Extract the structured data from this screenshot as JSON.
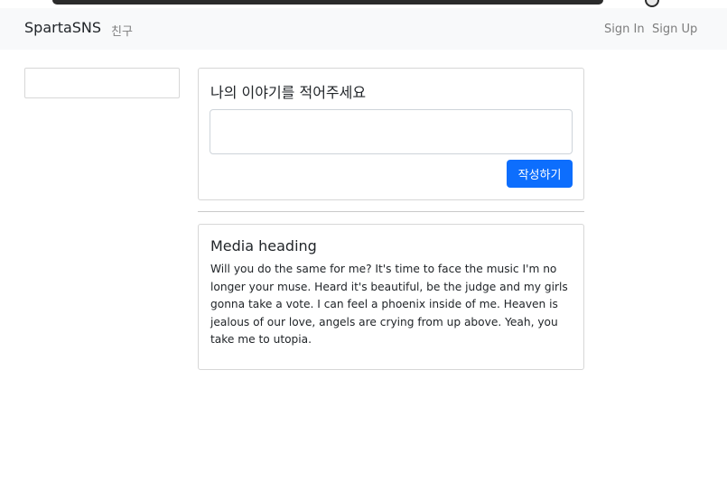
{
  "navbar": {
    "brand": "SpartaSNS",
    "friend_link": "친구",
    "sign_in": "Sign In",
    "sign_up": "Sign Up"
  },
  "compose": {
    "title": "나의 이야기를 적어주세요",
    "input_value": "",
    "submit_label": "작성하기"
  },
  "post": {
    "heading": "Media heading",
    "body": "Will you do the same for me? It's time to face the music I'm no longer your muse. Heard it's beautiful, be the judge and my girls gonna take a vote. I can feel a phoenix inside of me. Heaven is jealous of our love, angels are crying from up above. Yeah, you take me to utopia."
  },
  "colors": {
    "primary": "#0d6efd",
    "navbar_bg": "#f8f9fa",
    "border": "#d7d7d7",
    "muted_text": "#7d7d7d"
  }
}
